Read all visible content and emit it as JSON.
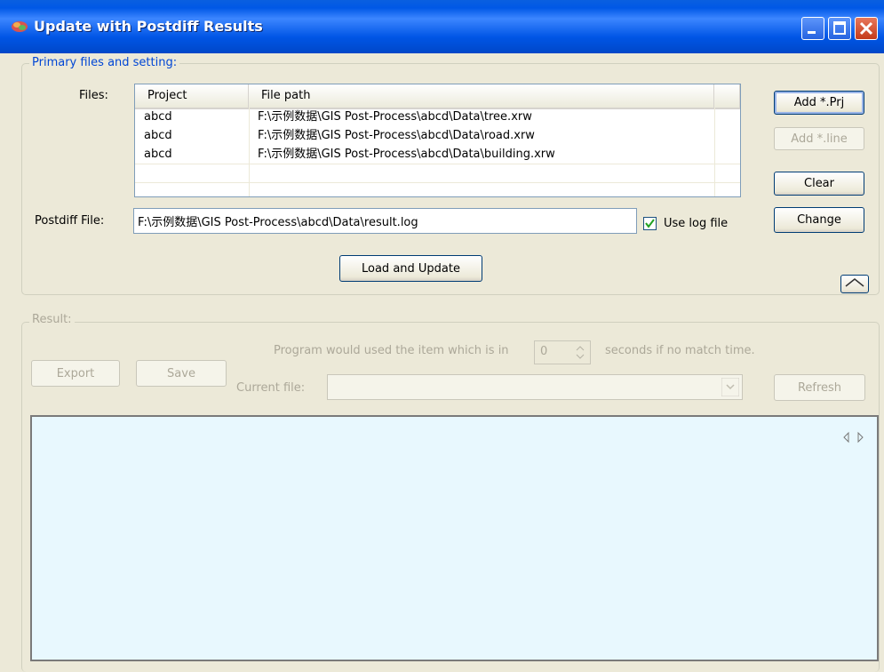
{
  "window": {
    "title": "Update with Postdiff Results"
  },
  "primary_group": {
    "legend": "Primary files and setting:",
    "files_label": "Files:",
    "columns": [
      "Project",
      "File path"
    ],
    "rows": [
      {
        "project": "abcd",
        "path": "F:\\示例数据\\GIS Post-Process\\abcd\\Data\\tree.xrw"
      },
      {
        "project": "abcd",
        "path": "F:\\示例数据\\GIS Post-Process\\abcd\\Data\\road.xrw"
      },
      {
        "project": "abcd",
        "path": "F:\\示例数据\\GIS Post-Process\\abcd\\Data\\building.xrw"
      }
    ],
    "buttons": {
      "add_prj": "Add *.Prj",
      "add_line": "Add *.line",
      "clear": "Clear",
      "change": "Change",
      "load_update": "Load and Update"
    },
    "postdiff_label": "Postdiff File:",
    "postdiff_value": "F:\\示例数据\\GIS Post-Process\\abcd\\Data\\result.log",
    "use_log_label": "Use log file",
    "use_log_checked": true
  },
  "result_group": {
    "legend": "Result:",
    "export": "Export",
    "save": "Save",
    "program_text_before": "Program would used the item which is in",
    "seconds_value": "0",
    "program_text_after": "seconds if no match time.",
    "current_file_label": "Current file:",
    "refresh": "Refresh"
  },
  "colors": {
    "titlebar": "#0058e6",
    "dialog_bg": "#ece9d8",
    "result_area_bg": "#e8f8fe",
    "disabled_text": "#aca899"
  }
}
